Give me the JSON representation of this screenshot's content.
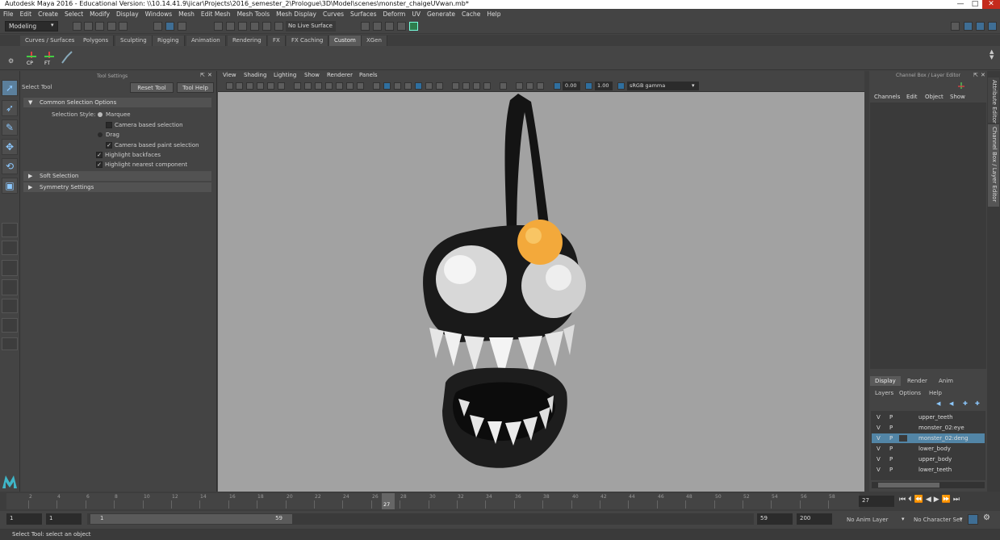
{
  "window": {
    "title": "Autodesk Maya 2016 - Educational Version: \\\\10.14.41.9\\jicar\\Projects\\2016_semester_2\\Prologue\\3D\\Model\\scenes\\monster_chaigeUVwan.mb*",
    "minimize": "—",
    "maximize": "□",
    "close": "✕"
  },
  "menubar": [
    "File",
    "Edit",
    "Create",
    "Select",
    "Modify",
    "Display",
    "Windows",
    "Mesh",
    "Edit Mesh",
    "Mesh Tools",
    "Mesh Display",
    "Curves",
    "Surfaces",
    "Deform",
    "UV",
    "Generate",
    "Cache",
    "Help"
  ],
  "statusline": {
    "mode": "Modeling",
    "live_surface": "No Live Surface"
  },
  "shelf_tabs": [
    "Curves / Surfaces",
    "Polygons",
    "Sculpting",
    "Rigging",
    "Animation",
    "Rendering",
    "FX",
    "FX Caching",
    "Custom",
    "XGen"
  ],
  "shelf_active": "Custom",
  "shelf_icons": {
    "cp": "CP",
    "ft": "FT"
  },
  "tool_settings": {
    "panel_title": "Tool Settings",
    "tool_name": "Select Tool",
    "reset_tool": "Reset Tool",
    "tool_help": "Tool Help",
    "section_common": "Common Selection Options",
    "selection_style_label": "Selection Style:",
    "marquee": "Marquee",
    "camera_based_selection": "Camera based selection",
    "drag": "Drag",
    "camera_based_paint_selection": "Camera based paint selection",
    "highlight_backfaces": "Highlight backfaces",
    "highlight_nearest_component": "Highlight nearest component",
    "section_soft": "Soft Selection",
    "section_symmetry": "Symmetry Settings"
  },
  "viewport": {
    "menu": [
      "View",
      "Shading",
      "Lighting",
      "Show",
      "Renderer",
      "Panels"
    ],
    "exposure": "0.00",
    "gamma": "1.00",
    "color_space": "sRGB gamma"
  },
  "channel_box": {
    "title": "Channel Box / Layer Editor",
    "menu": [
      "Channels",
      "Edit",
      "Object",
      "Show"
    ],
    "layer_tabs": [
      "Display",
      "Render",
      "Anim"
    ],
    "layer_menu": [
      "Layers",
      "Options",
      "Help"
    ],
    "layers": [
      {
        "v": "V",
        "p": "P",
        "name": "upper_teeth",
        "selected": false
      },
      {
        "v": "V",
        "p": "P",
        "name": "monster_02:eye",
        "selected": false
      },
      {
        "v": "V",
        "p": "P",
        "name": "monster_02:deng",
        "selected": true
      },
      {
        "v": "V",
        "p": "P",
        "name": "lower_body",
        "selected": false
      },
      {
        "v": "V",
        "p": "P",
        "name": "upper_body",
        "selected": false
      },
      {
        "v": "V",
        "p": "P",
        "name": "lower_teeth",
        "selected": false
      }
    ]
  },
  "side_tabs": {
    "attribute_editor": "Attribute Editor",
    "channel_box": "Channel Box / Layer Editor"
  },
  "timeline": {
    "ticks": [
      "2",
      "4",
      "6",
      "8",
      "10",
      "12",
      "14",
      "16",
      "18",
      "20",
      "22",
      "24",
      "26",
      "28",
      "30",
      "32",
      "34",
      "36",
      "38",
      "40",
      "42",
      "44",
      "46",
      "48",
      "50",
      "52",
      "54",
      "56",
      "58"
    ],
    "current_frame_marker": "27",
    "current_frame": "27"
  },
  "range": {
    "start": "1",
    "start_inner": "1",
    "slider_start": "1",
    "slider_end": "59",
    "end_inner": "59",
    "end": "200",
    "anim_layer": "No Anim Layer",
    "character_set": "No Character Set"
  },
  "help_line": "Select Tool: select an object",
  "colors": {
    "viewport_bg": "#a2a2a2",
    "selected_layer": "#5285a6",
    "active_tool": "#5b7f9c",
    "bulb": "#f3a93b"
  }
}
